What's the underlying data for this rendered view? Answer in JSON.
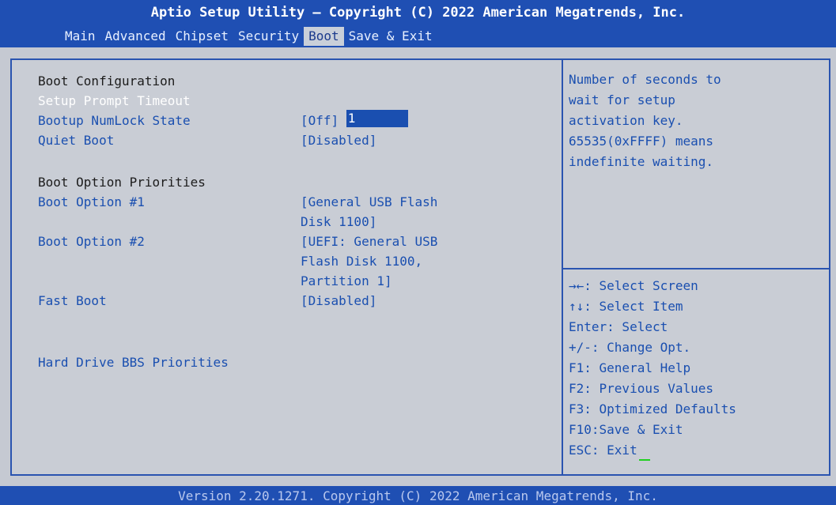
{
  "header": {
    "title": "Aptio Setup Utility – Copyright (C) 2022 American Megatrends, Inc.",
    "tabs": [
      "Main",
      "Advanced",
      "Chipset",
      "Security",
      "Boot",
      "Save & Exit"
    ],
    "active_tab": "Boot"
  },
  "main": {
    "section1": "Boot Configuration",
    "setup_prompt_timeout": {
      "label": "Setup Prompt Timeout",
      "value": "1"
    },
    "bootup_numlock": {
      "label": "Bootup NumLock State",
      "value": "[Off]"
    },
    "quiet_boot": {
      "label": "Quiet Boot",
      "value": "[Disabled]"
    },
    "section2": "Boot Option Priorities",
    "boot_option_1": {
      "label": "Boot Option #1",
      "value_line1": "[General USB Flash",
      "value_line2": "Disk 1100]"
    },
    "boot_option_2": {
      "label": "Boot Option #2",
      "value_line1": "[UEFI: General USB",
      "value_line2": "Flash Disk 1100,",
      "value_line3": "Partition 1]"
    },
    "fast_boot": {
      "label": "Fast Boot",
      "value": "[Disabled]"
    },
    "hdd_bbs": "Hard Drive BBS Priorities"
  },
  "help": {
    "lines": [
      "Number of seconds to",
      "wait for setup",
      "activation key.",
      "65535(0xFFFF) means",
      "indefinite waiting."
    ]
  },
  "keys": {
    "select_screen": "→←: Select Screen",
    "select_item": "↑↓: Select Item",
    "enter": "Enter: Select",
    "change_opt": "+/-: Change Opt.",
    "f1": "F1: General Help",
    "f2": "F2: Previous Values",
    "f3": "F3: Optimized Defaults",
    "f10": "F10:Save & Exit",
    "esc": "ESC: Exit"
  },
  "footer": {
    "text": "Version 2.20.1271. Copyright (C) 2022 American Megatrends, Inc."
  },
  "colors": {
    "header_bg": "#1f4fb3",
    "panel_bg": "#c9cdd5",
    "accent_blue": "#1a4fb0",
    "selected_bg": "#1a4fb0"
  }
}
